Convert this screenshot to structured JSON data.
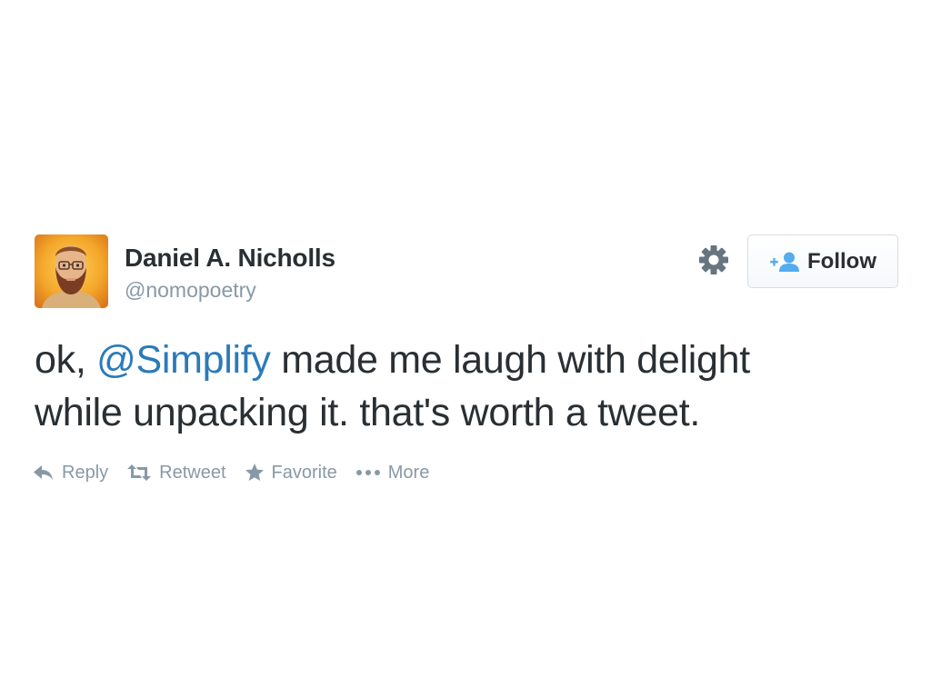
{
  "tweet": {
    "author": {
      "name": "Daniel A. Nicholls",
      "handle": "@nomopoetry"
    },
    "text": {
      "prefix": "ok, ",
      "mention": "@Simplify",
      "line1_suffix": " made me laugh with delight",
      "line2": "while unpacking it. that's worth a tweet."
    },
    "follow_label": "Follow",
    "actions": {
      "reply": "Reply",
      "retweet": "Retweet",
      "favorite": "Favorite",
      "more": "More"
    }
  },
  "icons": {
    "settings": "gear-icon",
    "follow": "add-user-icon",
    "reply": "reply-arrow-icon",
    "retweet": "retweet-icon",
    "favorite": "star-icon",
    "more": "ellipsis-icon"
  },
  "colors": {
    "text": "#292f33",
    "muted": "#8899a6",
    "mention": "#2b7bb9",
    "follow_icon": "#55acee",
    "avatar_background": "#f1a023"
  }
}
